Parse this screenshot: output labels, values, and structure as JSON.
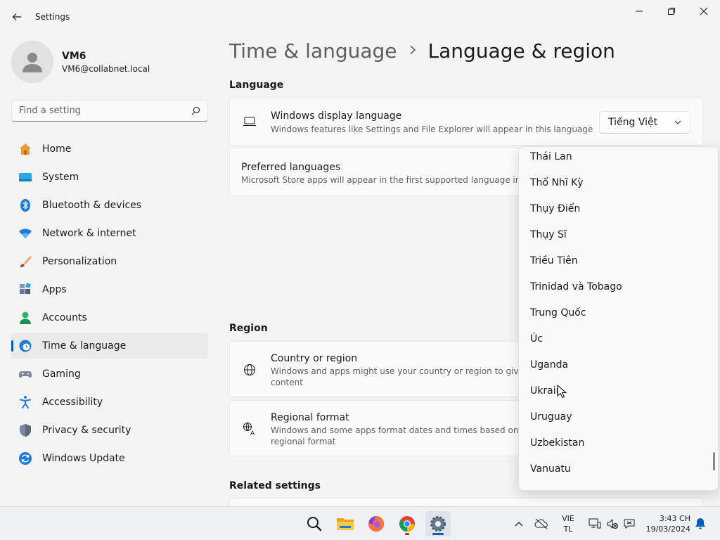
{
  "window": {
    "title": "Settings"
  },
  "user": {
    "name": "VM6",
    "email": "VM6@collabnet.local"
  },
  "search": {
    "placeholder": "Find a setting"
  },
  "nav": [
    {
      "label": "Home",
      "icon": "home-icon"
    },
    {
      "label": "System",
      "icon": "system-icon"
    },
    {
      "label": "Bluetooth & devices",
      "icon": "bluetooth-icon"
    },
    {
      "label": "Network & internet",
      "icon": "wifi-icon"
    },
    {
      "label": "Personalization",
      "icon": "brush-icon"
    },
    {
      "label": "Apps",
      "icon": "apps-icon"
    },
    {
      "label": "Accounts",
      "icon": "accounts-icon"
    },
    {
      "label": "Time & language",
      "icon": "time-language-icon",
      "active": true
    },
    {
      "label": "Gaming",
      "icon": "gamepad-icon"
    },
    {
      "label": "Accessibility",
      "icon": "accessibility-icon"
    },
    {
      "label": "Privacy & security",
      "icon": "shield-icon"
    },
    {
      "label": "Windows Update",
      "icon": "update-icon"
    }
  ],
  "breadcrumb": {
    "parent": "Time & language",
    "current": "Language & region"
  },
  "language_section": {
    "title": "Language",
    "display_language": {
      "title": "Windows display language",
      "desc": "Windows features like Settings and File Explorer will appear in this language",
      "value": "Tiếng Việt"
    },
    "preferred": {
      "title": "Preferred languages",
      "desc": "Microsoft Store apps will appear in the first supported language in this lis"
    }
  },
  "region_section": {
    "title": "Region",
    "country": {
      "title": "Country or region",
      "desc_line1": "Windows and apps might use your country or region to give you",
      "desc_line2": "content"
    },
    "format": {
      "title": "Regional format",
      "desc_line1": "Windows and some apps format dates and times based on your",
      "desc_line2": "regional format"
    }
  },
  "related": {
    "title": "Related settings"
  },
  "country_dropdown": {
    "items": [
      "Thái Lan",
      "Thổ Nhĩ Kỳ",
      "Thụy Điển",
      "Thụy Sĩ",
      "Triều Tiên",
      "Trinidad và Tobago",
      "Trung Quốc",
      "Úc",
      "Uganda",
      "Ukrain",
      "Uruguay",
      "Uzbekistan",
      "Vanuatu"
    ]
  },
  "taskbar": {
    "apps": [
      "search-icon",
      "file-explorer-icon",
      "firefox-icon",
      "chrome-icon",
      "settings-icon"
    ],
    "language_line1": "VIE",
    "language_line2": "TL",
    "time": "3:43 CH",
    "date": "19/03/2024"
  },
  "colors": {
    "accent": "#005fb8",
    "background": "#f3f3f3",
    "card": "#fbfbfb"
  }
}
